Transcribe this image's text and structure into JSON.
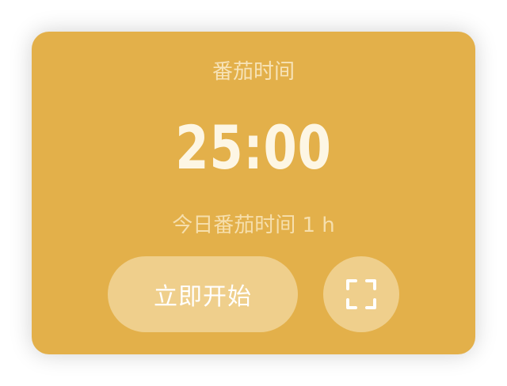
{
  "card": {
    "title": "番茄时间",
    "timer": "25:00",
    "today_summary": "今日番茄时间 1 h",
    "start_label": "立即开始",
    "fullscreen_icon": "fullscreen-icon"
  },
  "colors": {
    "card_background": "#e3b04a",
    "button_background": "#efcf8c",
    "timer_text": "#fdf6e4",
    "label_text": "#f7e3b8"
  }
}
